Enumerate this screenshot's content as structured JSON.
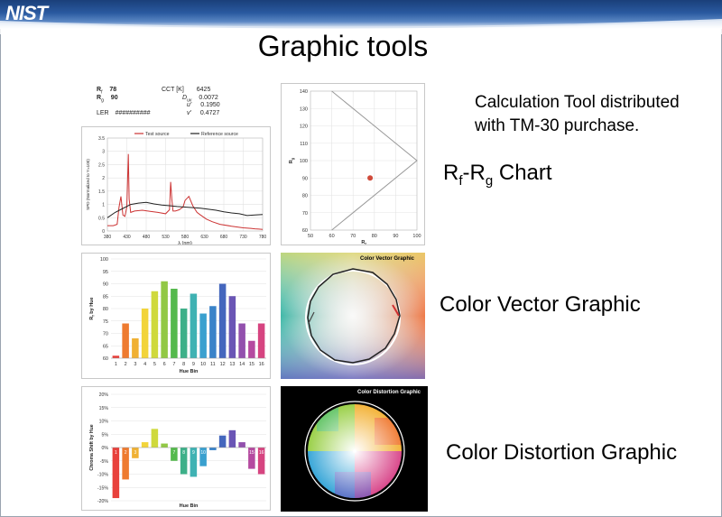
{
  "header": {
    "logo_text": "NIST",
    "bar_color": "#1a3f7a"
  },
  "slide": {
    "title": "Graphic tools"
  },
  "note": {
    "line1": "Calculation Tool distributed",
    "line2": "with TM-30 purchase."
  },
  "labels": {
    "rf_rg_prefix": "R",
    "rf_sub": "f",
    "rf_rg_dash": "-R",
    "rg_sub": "g",
    "rf_rg_suffix": " Chart",
    "cvg": "Color Vector Graphic",
    "cdg": "Color Distortion Graphic"
  },
  "metrics": {
    "rf_label": "R",
    "rf_sub": "f",
    "rf_value": "78",
    "rg_label": "R",
    "rg_sub": "g",
    "rg_value": "90",
    "ler_label": "LER",
    "ler_value": "##########",
    "cct_label": "CCT [K]",
    "cct_value": "6425",
    "duv_label": "D",
    "duv_sub": "uv",
    "duv_value": "0.0072",
    "u_label": "u'",
    "u_value": "0.1950",
    "v_label": "v'",
    "v_value": "0.4727"
  },
  "thumbs": {
    "cvg_title": "Color  Vector Graphic",
    "cdg_title": "Color Distortion Graphic"
  },
  "chart_data": [
    {
      "type": "line",
      "id": "spd",
      "legend": [
        "Test source",
        "Reference source"
      ],
      "colors": [
        "#cc3333",
        "#222222"
      ],
      "ylabel": "SPD (Normalized to Y=100)",
      "xlabel": "λ (nm)",
      "xlim": [
        380,
        780
      ],
      "ylim": [
        0,
        3.5
      ],
      "xticks": [
        380,
        430,
        480,
        530,
        580,
        630,
        680,
        730,
        780
      ],
      "yticks": [
        0,
        0.5,
        1,
        1.5,
        2,
        2.5,
        3,
        3.5
      ],
      "series": [
        {
          "name": "Test source",
          "x": [
            380,
            395,
            405,
            410,
            415,
            420,
            425,
            430,
            434,
            436,
            440,
            450,
            470,
            490,
            510,
            530,
            540,
            543,
            546,
            549,
            555,
            565,
            575,
            580,
            590,
            600,
            611,
            620,
            635,
            650,
            670,
            700,
            730,
            750,
            760,
            770,
            780
          ],
          "y": [
            0.2,
            0.2,
            0.25,
            0.9,
            1.3,
            0.6,
            0.55,
            0.9,
            2.9,
            1.2,
            0.7,
            0.75,
            0.78,
            0.74,
            0.7,
            0.65,
            0.8,
            1.85,
            1.2,
            0.75,
            0.75,
            0.8,
            0.9,
            1.15,
            1.3,
            0.95,
            0.7,
            0.6,
            0.45,
            0.35,
            0.25,
            0.18,
            0.12,
            0.1,
            0.08,
            0.07,
            0.06
          ]
        },
        {
          "name": "Reference source",
          "x": [
            380,
            400,
            420,
            440,
            460,
            480,
            500,
            520,
            540,
            560,
            580,
            600,
            620,
            640,
            660,
            680,
            700,
            720,
            740,
            760,
            780
          ],
          "y": [
            0.5,
            0.7,
            0.85,
            1.0,
            1.05,
            1.08,
            1.02,
            0.98,
            0.95,
            0.92,
            0.9,
            0.88,
            0.86,
            0.82,
            0.78,
            0.72,
            0.68,
            0.65,
            0.58,
            0.6,
            0.62
          ]
        }
      ]
    },
    {
      "type": "scatter",
      "id": "rfrg",
      "xlabel": "R",
      "xlabel_sub": "f",
      "ylabel": "R",
      "ylabel_sub": "g",
      "xlim": [
        50,
        100
      ],
      "ylim": [
        60,
        140
      ],
      "xticks": [
        50,
        60,
        70,
        80,
        90,
        100
      ],
      "yticks": [
        60,
        70,
        80,
        90,
        100,
        110,
        120,
        130,
        140
      ],
      "points": [
        {
          "x": 78,
          "y": 90
        }
      ],
      "point_color": "#d04a3a"
    },
    {
      "type": "bar",
      "id": "rfhue",
      "xlabel": "Hue Bin",
      "ylabel": "R",
      "ylabel_sub": "f",
      "ylabel_suffix": " by Hue",
      "ylim": [
        0,
        100
      ],
      "yticks": [
        60,
        65,
        70,
        75,
        80,
        85,
        90,
        95,
        100
      ],
      "categories": [
        "1",
        "2",
        "3",
        "4",
        "5",
        "6",
        "7",
        "8",
        "9",
        "10",
        "11",
        "12",
        "13",
        "14",
        "15",
        "16"
      ],
      "values": [
        61,
        74,
        68,
        80,
        87,
        91,
        88,
        80,
        86,
        78,
        81,
        90,
        85,
        74,
        67,
        74
      ],
      "colors": [
        "#e8413c",
        "#ee7b30",
        "#f0b134",
        "#f2d43a",
        "#cfd93c",
        "#92c845",
        "#55b94d",
        "#3db089",
        "#3fb2b3",
        "#3aa0cf",
        "#3a83c9",
        "#4466bd",
        "#6a55b5",
        "#9250ad",
        "#b54aa0",
        "#d64480"
      ]
    },
    {
      "type": "bar",
      "id": "chroma",
      "xlabel": "Hue Bin",
      "ylabel": "Chroma Shift by Hue",
      "ylim": [
        -0.2,
        0.2
      ],
      "yticks": [
        "-20%",
        "-15%",
        "-10%",
        "-5%",
        "0%",
        "5%",
        "10%",
        "15%",
        "20%"
      ],
      "categories": [
        "1",
        "2",
        "3",
        "4",
        "5",
        "6",
        "7",
        "8",
        "9",
        "10",
        "11",
        "12",
        "13",
        "14",
        "15",
        "16"
      ],
      "values": [
        -0.19,
        -0.12,
        -0.04,
        0.02,
        0.07,
        0.015,
        -0.05,
        -0.1,
        -0.11,
        -0.07,
        -0.01,
        0.045,
        0.065,
        0.02,
        -0.08,
        -0.1
      ],
      "colors": [
        "#e8413c",
        "#ee7b30",
        "#f0b134",
        "#f2d43a",
        "#cfd93c",
        "#92c845",
        "#55b94d",
        "#3db089",
        "#3fb2b3",
        "#3aa0cf",
        "#3a83c9",
        "#4466bd",
        "#6a55b5",
        "#9250ad",
        "#b54aa0",
        "#d64480"
      ]
    }
  ]
}
